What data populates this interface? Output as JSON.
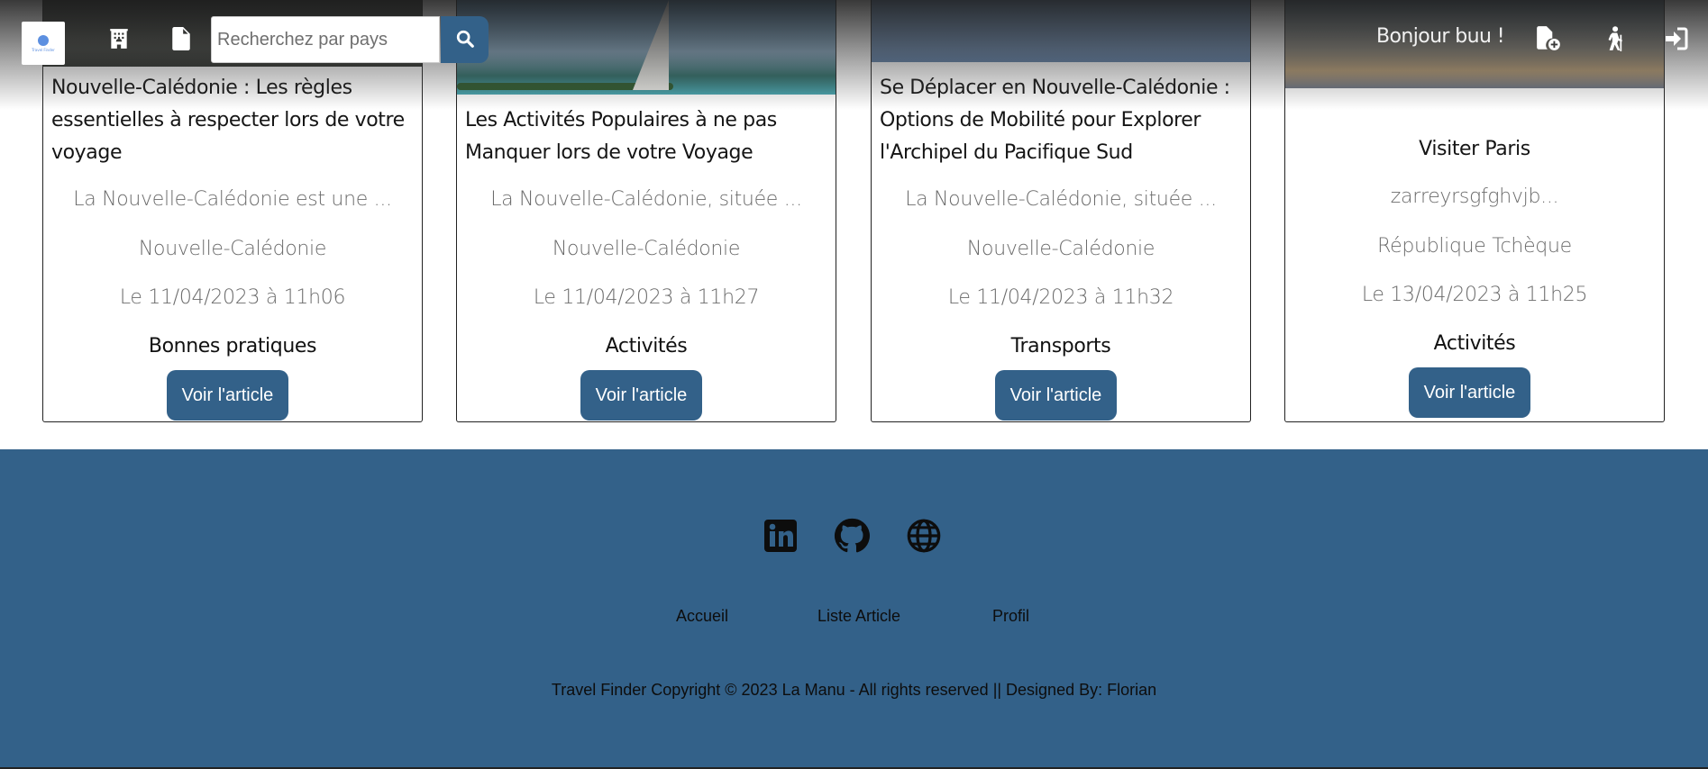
{
  "header": {
    "logo_label": "Travel Finder",
    "search_placeholder": "Recherchez par pays",
    "greeting": "Bonjour buu !",
    "icons": [
      "hotel-icon",
      "document-icon",
      "search-icon",
      "add-file-icon",
      "hiking-icon",
      "sign-in-icon"
    ]
  },
  "cards": [
    {
      "title": "Nouvelle-Calédonie : Les règles essentielles à respecter lors de votre voyage",
      "excerpt": "La Nouvelle-Calédonie est une ...",
      "country": "Nouvelle-Calédonie",
      "date": "Le 11/04/2023 à 11h06",
      "category": "Bonnes pratiques",
      "button": "Voir l'article"
    },
    {
      "title": "Les Activités Populaires à ne pas Manquer lors de votre Voyage",
      "excerpt": "La Nouvelle-Calédonie, située ...",
      "country": "Nouvelle-Calédonie",
      "date": "Le 11/04/2023 à 11h27",
      "category": "Activités",
      "button": "Voir l'article"
    },
    {
      "title": "Se Déplacer en Nouvelle-Calédonie : Options de Mobilité pour Explorer l'Archipel du Pacifique Sud",
      "excerpt": "La Nouvelle-Calédonie, située ...",
      "country": "Nouvelle-Calédonie",
      "date": "Le 11/04/2023 à 11h32",
      "category": "Transports",
      "button": "Voir l'article"
    },
    {
      "title": "Visiter Paris",
      "excerpt": "zarreyrsgfghvjb...",
      "country": "République Tchèque",
      "date": "Le 13/04/2023 à 11h25",
      "category": "Activités",
      "button": "Voir l'article"
    }
  ],
  "footer": {
    "social_icons": [
      "linkedin-icon",
      "github-icon",
      "globe-icon"
    ],
    "links": [
      "Accueil",
      "Liste Article",
      "Profil"
    ],
    "copyright": "Travel Finder Copyright © 2023 La Manu - All rights reserved || Designed By: Florian"
  },
  "colors": {
    "primary": "#336189",
    "text_dark": "#151515",
    "text_muted": "#6b6b6b"
  }
}
